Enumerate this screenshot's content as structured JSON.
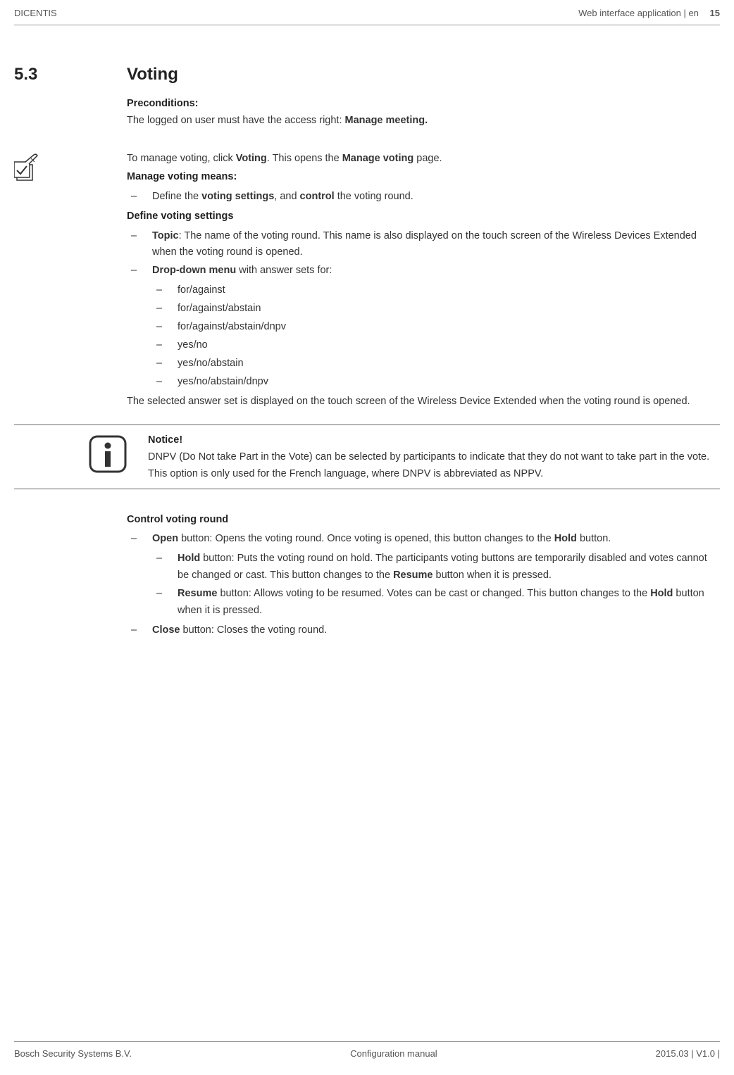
{
  "header": {
    "left": "DICENTIS",
    "right": "Web interface application | en",
    "page_num": "15"
  },
  "footer": {
    "left": "Bosch Security Systems B.V.",
    "center": "Configuration manual",
    "right": "2015.03 | V1.0 |"
  },
  "section_number": "5.3",
  "section_title": "Voting",
  "preconditions": {
    "heading": "Preconditions:",
    "text_before": "The logged on user must have the access right: ",
    "bold": "Manage meeting."
  },
  "intro": {
    "p1a": "To manage voting, click ",
    "p1b": "Voting",
    "p1c": ". This opens the ",
    "p1d": "Manage voting",
    "p1e": " page."
  },
  "manage_means": {
    "heading": "Manage voting means:",
    "item_a": "Define the ",
    "item_bold1": "voting settings",
    "item_b": ", and ",
    "item_bold2": "control",
    "item_c": " the voting round."
  },
  "define_settings": {
    "heading": "Define voting settings",
    "topic_bold": "Topic",
    "topic_text": ": The name of the voting round. This name is also displayed on the touch screen of the Wireless Devices Extended when the voting round is opened.",
    "dropdown_bold": "Drop-down menu",
    "dropdown_text": " with answer sets for:",
    "answers": [
      "for/against",
      "for/against/abstain",
      "for/against/abstain/dnpv",
      "yes/no",
      "yes/no/abstain",
      "yes/no/abstain/dnpv"
    ],
    "trailing": "The selected answer set is displayed on the touch screen of the Wireless Device Extended when the voting round is opened."
  },
  "notice": {
    "heading": "Notice!",
    "text": "DNPV (Do Not take Part in the Vote) can be selected by participants to indicate that they do not want to take part in the vote. This option is only used for the French language, where DNPV is abbreviated as NPPV."
  },
  "control": {
    "heading": "Control voting round",
    "open_bold": "Open",
    "open_a": " button: Opens the voting round. Once voting is opened, this button changes to the ",
    "open_hold_bold": "Hold",
    "open_b": " button.",
    "hold_bold": "Hold",
    "hold_a": " button: Puts the voting round on hold. The participants voting buttons are temporarily disabled and votes cannot be changed or cast. This button changes to the ",
    "hold_resume_bold": "Resume",
    "hold_b": " button when it is pressed.",
    "resume_bold": "Resume",
    "resume_a": " button: Allows voting to be resumed. Votes can be cast or changed. This button changes to the ",
    "resume_hold_bold": "Hold",
    "resume_b": " button when it is pressed.",
    "close_bold": "Close",
    "close_text": " button: Closes the voting round."
  }
}
